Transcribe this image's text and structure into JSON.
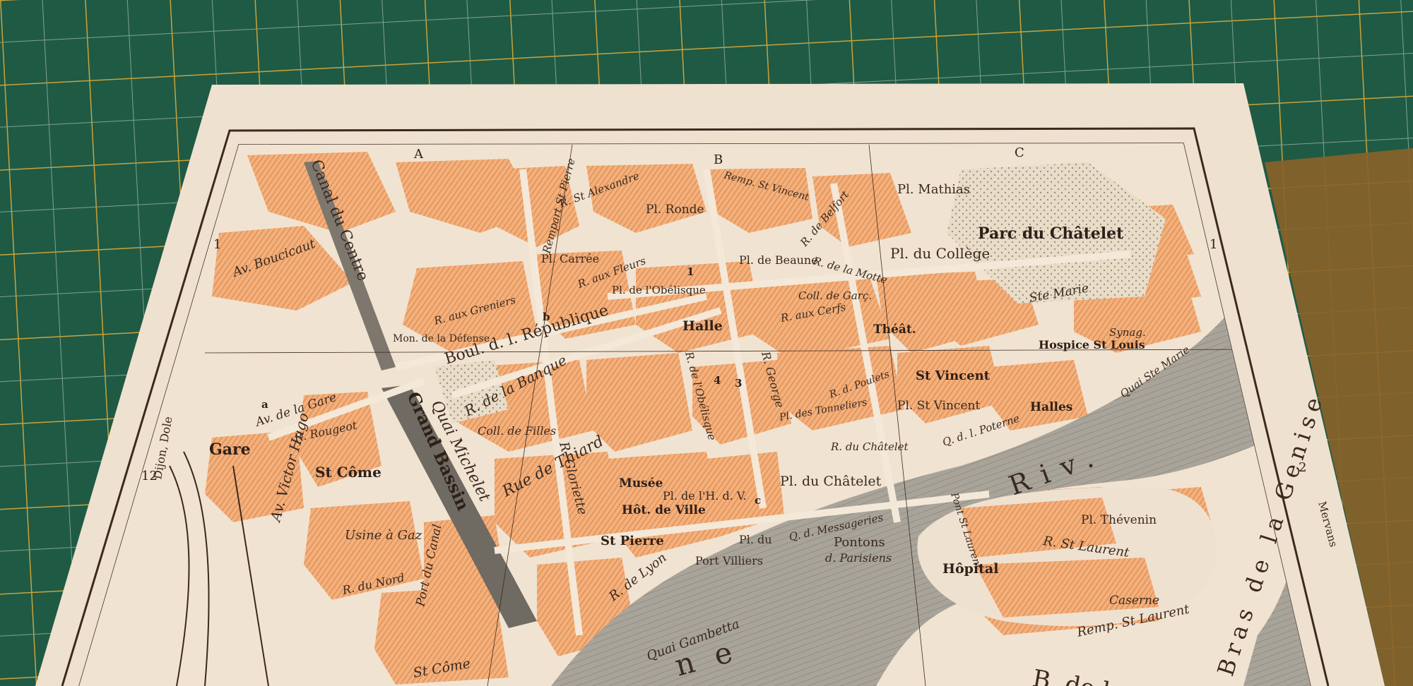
{
  "map": {
    "column_letters": [
      "A",
      "B",
      "C"
    ],
    "row_numbers_left": [
      "1",
      "2"
    ],
    "row_numbers_right": [
      "1",
      "2"
    ],
    "margin_notes": {
      "left_dijon": "Dijon, Dole",
      "left_num": "12",
      "right_mervans": "Mervans"
    },
    "labels": {
      "canal_centre": "Canal du Centre",
      "av_boucicaut": "Av. Boucicaut",
      "mon_defense": "Mon. de la Défense",
      "rempart_st_pierre": "Rempart St Pierre",
      "r_st_alexandre": "R. St Alexandre",
      "pl_ronde": "Pl. Ronde",
      "remp_st_vincent": "Remp. St Vincent",
      "r_de_belfort": "R. de Belfort",
      "pl_mathias": "Pl. Mathias",
      "parc_chatelet": "Parc du Châtelet",
      "pl_college": "Pl. du Collège",
      "pl_carree": "Pl. Carrée",
      "r_aux_fleurs": "R. aux Fleurs",
      "pl_obelisque": "Pl. de l'Obélisque",
      "pl_beaune": "Pl. de Beaune",
      "r_motte": "R. de la Motte",
      "coll_garcons": "Coll. de Garç.",
      "ste_marie": "Ste Marie",
      "r_aux_cerfs": "R. aux Cerfs",
      "theatre": "Théât.",
      "halle": "Halle",
      "boul_republique": "Boul. d. l. République",
      "r_aux_greniers": "R. aux Greniers",
      "synag": "Synag.",
      "hospice_st_louis": "Hospice St Louis",
      "quai_ste_marie": "Quai Ste Marie",
      "st_vincent": "St Vincent",
      "pl_st_vincent": "Pl. St Vincent",
      "halles": "Halles",
      "r_de_la_banque": "R. de la Banque",
      "r_obelisque": "R. de l'Obélisque",
      "r_george": "R. George",
      "r_poulets": "R. d. Poulets",
      "pl_des_tonneliers": "Pl. des Tonneliers",
      "av_de_la_gare": "Av. de la Gare",
      "r_rougeot": "R. Rougeot",
      "gare": "Gare",
      "st_come": "St Côme",
      "coll_filles": "Coll. de Filles",
      "r_gloriette": "R. Gloriette",
      "quai_michelet": "Quai Michelet",
      "grand_bassin": "Grand Bassin",
      "rue_de_thiard": "Rue de Thiard",
      "r_du_chatelet": "R. du Châtelet",
      "pl_du_chatelet": "Pl. du Châtelet",
      "q_poterne": "Q. d. l. Poterne",
      "riv": "Riv.",
      "pl_thevenin": "Pl. Thévenin",
      "av_victor_hugo": "Av. Victor Hugo",
      "musee": "Musée",
      "pl_hotel_ville": "Pl. de l'H. d. V.",
      "hot_de_ville": "Hôt. de Ville",
      "usine_gaz": "Usine à Gaz",
      "port_canal": "Port du Canal",
      "st_pierre": "St Pierre",
      "pl_pontons": "Pl. du",
      "q_messageries": "Q. d. Messageries",
      "pontons": "Pontons",
      "parisiens": "d. Parisiens",
      "pont_st_laurent": "Pont St Laurent",
      "r_st_laurent": "R. St Laurent",
      "hopital": "Hôpital",
      "caserne": "Caserne",
      "remp_st_laurent": "Remp. St Laurent",
      "genise": "Bras de la Genise",
      "r_du_nord": "R. du Nord",
      "r_de_lyon": "R. de Lyon",
      "port_villiers": "Port Villiers",
      "quai_gambetta": "Quai Gambetta",
      "river_ne": "ne",
      "st_come_bottom": "St Côme",
      "b_de_la": "B. de la",
      "num_1": "1",
      "num_2": "2",
      "num_3": "3",
      "num_4": "4",
      "letter_a": "a",
      "letter_b": "b",
      "letter_c": "c"
    },
    "colors": {
      "mat": "#1f5a45",
      "grid_line": "#c9a33a",
      "paper": "#efe1cf",
      "block": "#f0a56a",
      "block_hatch": "#e08a4a",
      "water": "#9a958c",
      "ink": "#3a2a20"
    }
  }
}
